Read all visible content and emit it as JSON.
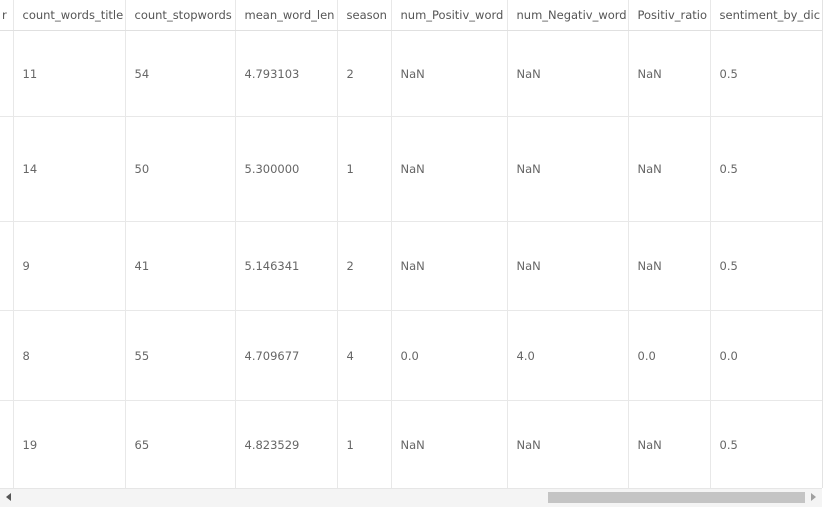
{
  "table": {
    "columns": [
      "r",
      "count_words_title",
      "count_stopwords",
      "mean_word_len",
      "season",
      "num_Positiv_word",
      "num_Negativ_word",
      "Positiv_ratio",
      "sentiment_by_dic"
    ],
    "rows": [
      [
        "",
        "11",
        "54",
        "4.793103",
        "2",
        "NaN",
        "NaN",
        "NaN",
        "0.5"
      ],
      [
        "",
        "14",
        "50",
        "5.300000",
        "1",
        "NaN",
        "NaN",
        "NaN",
        "0.5"
      ],
      [
        "",
        "9",
        "41",
        "5.146341",
        "2",
        "NaN",
        "NaN",
        "NaN",
        "0.5"
      ],
      [
        "",
        "8",
        "55",
        "4.709677",
        "4",
        "0.0",
        "4.0",
        "0.0",
        "0.0"
      ],
      [
        "",
        "19",
        "65",
        "4.823529",
        "1",
        "NaN",
        "NaN",
        "NaN",
        "0.5"
      ]
    ]
  },
  "scrollbar": {
    "left_icon": "arrow-left-icon",
    "right_icon": "arrow-right-icon",
    "position": 0.67
  }
}
